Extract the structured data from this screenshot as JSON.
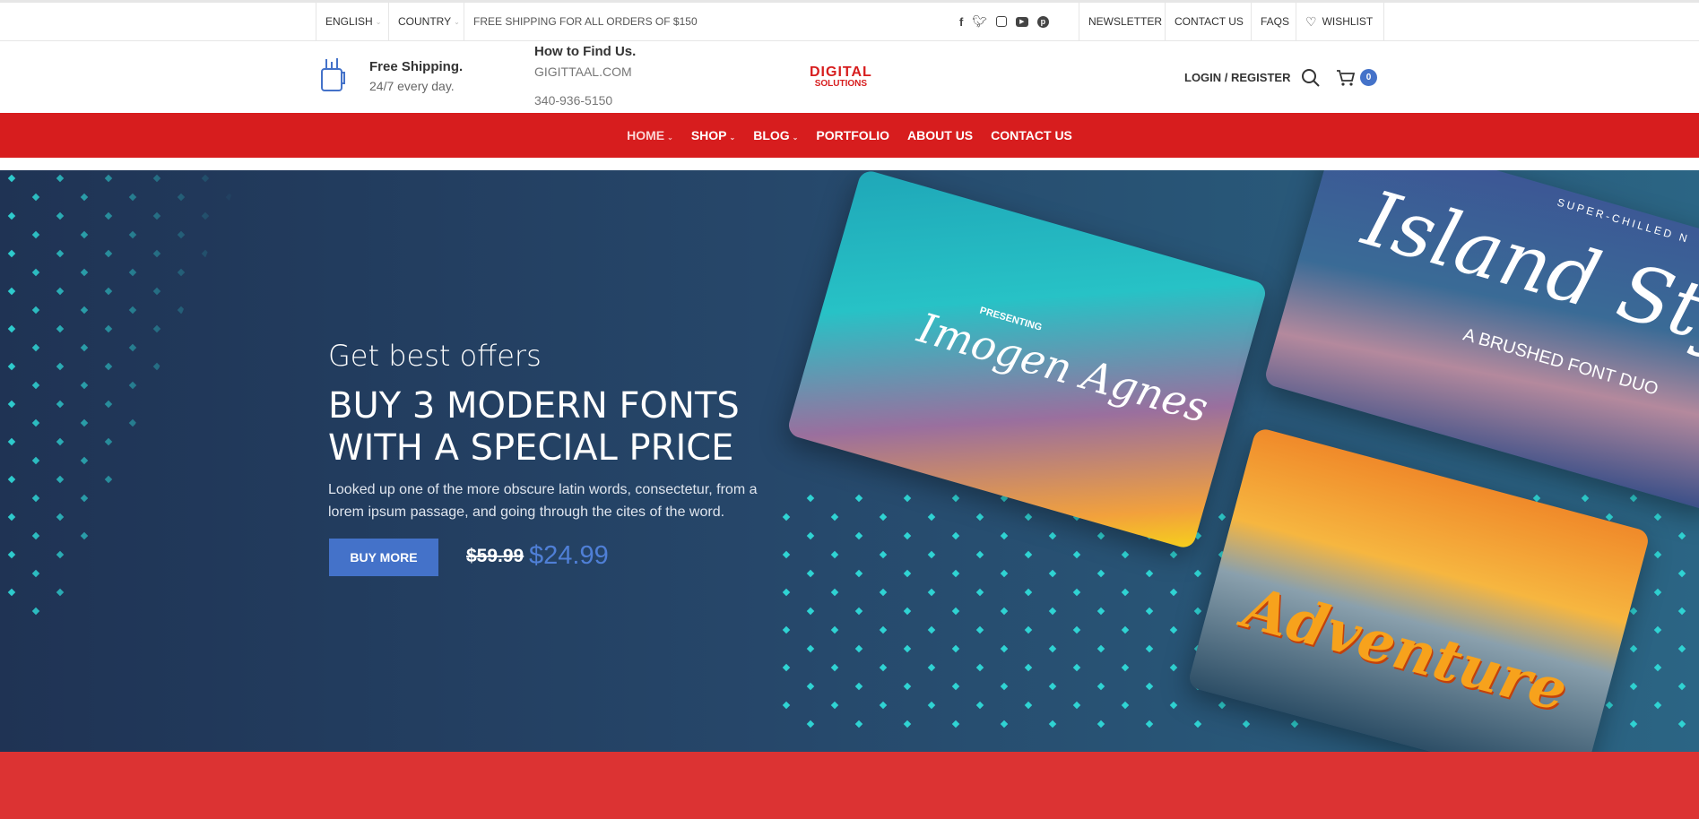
{
  "topbar": {
    "language": "ENGLISH",
    "country": "COUNTRY",
    "promo": "FREE SHIPPING FOR ALL ORDERS OF $150",
    "links": [
      "NEWSLETTER",
      "CONTACT US",
      "FAQS"
    ],
    "wishlist": "WISHLIST",
    "socials": [
      "facebook-icon",
      "twitter-icon",
      "instagram-icon",
      "youtube-icon",
      "pinterest-icon"
    ]
  },
  "header": {
    "shipping_title": "Free Shipping.",
    "shipping_sub": "24/7 every day.",
    "find_title": "How to Find Us.",
    "website": "GIGITTAAL.COM",
    "phone": "340-936-5150",
    "logo_line1": "DIGITAL",
    "logo_line2": "SOLUTIONS",
    "login": "LOGIN / REGISTER",
    "cart_count": "0"
  },
  "nav": {
    "items": [
      {
        "label": "HOME",
        "dropdown": true
      },
      {
        "label": "SHOP",
        "dropdown": true
      },
      {
        "label": "BLOG",
        "dropdown": true
      },
      {
        "label": "PORTFOLIO"
      },
      {
        "label": "ABOUT US"
      },
      {
        "label": "CONTACT US"
      }
    ]
  },
  "hero": {
    "subtitle": "Get best offers",
    "title_line1": "BUY 3 MODERN FONTS",
    "title_line2": "WITH A SPECIAL PRICE",
    "description_line1": "Looked up one of the more obscure latin words, consectetur, from a",
    "description_line2": "lorem ipsum passage, and going through the cites of the word.",
    "button": "BUY MORE",
    "old_price": "$59.99",
    "new_price": "$24.99",
    "cards": [
      {
        "small": "PRESENTING",
        "title": "Imogen Agnes"
      },
      {
        "small": "SUPER-CHILLED N",
        "title": "Island Sty",
        "sub": "A BRUSHED FONT DUO"
      },
      {
        "title": "Adventure"
      }
    ]
  },
  "colors": {
    "red": "#d71d1e",
    "blue": "#4472c9",
    "dot": "#2fd3d3"
  }
}
